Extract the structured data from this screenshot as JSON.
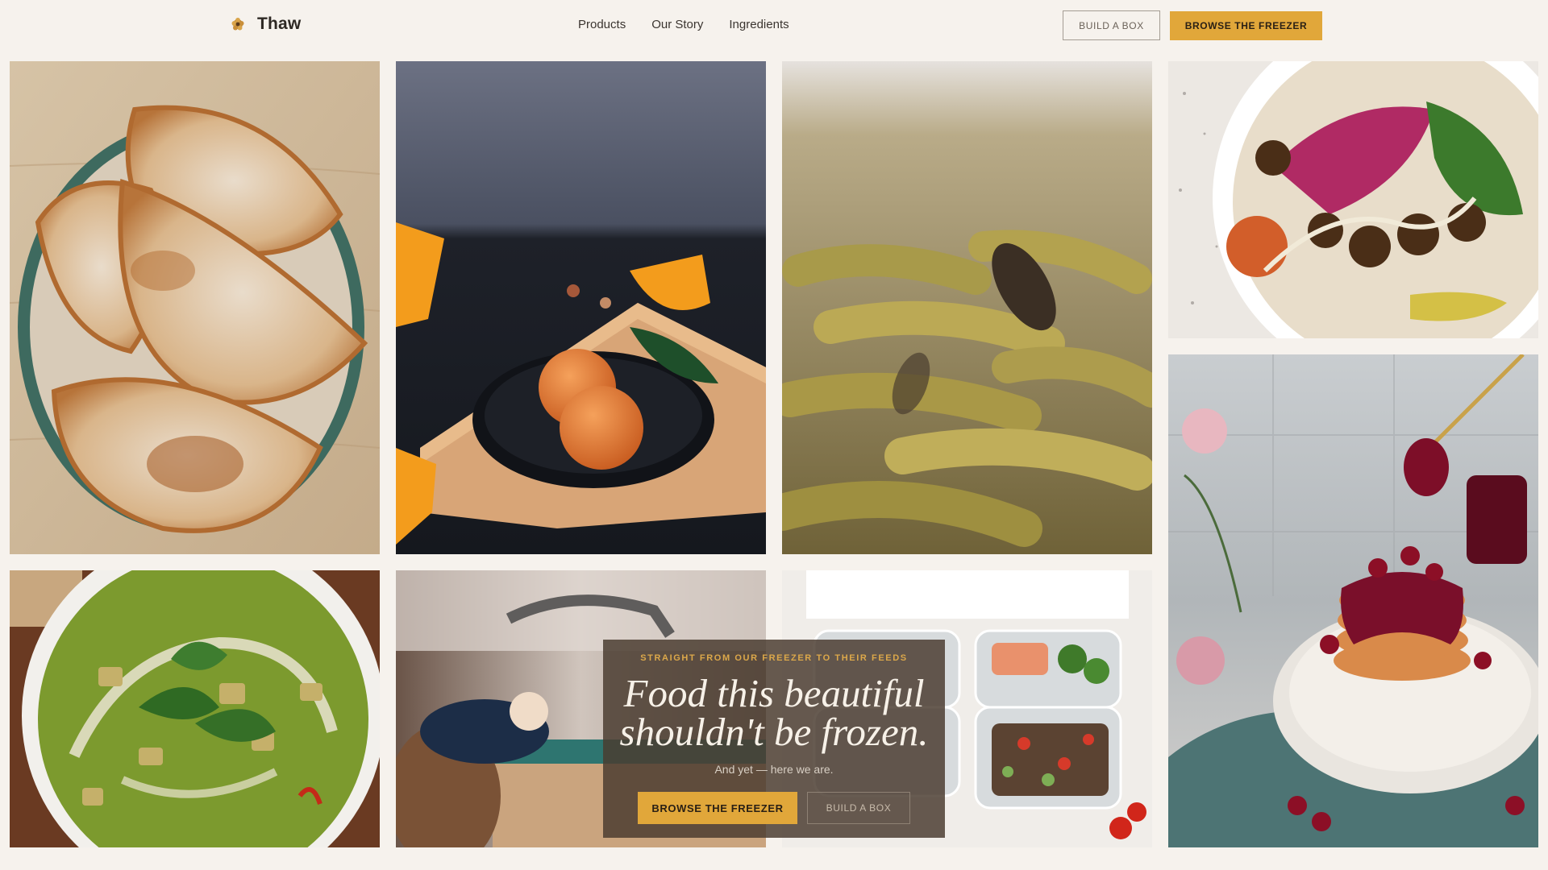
{
  "brand": {
    "name": "Thaw",
    "logo_icon": "flower-icon",
    "accent": "#e1a73a"
  },
  "nav": [
    {
      "label": "Products"
    },
    {
      "label": "Our Story"
    },
    {
      "label": "Ingredients"
    }
  ],
  "header_actions": {
    "build_label": "BUILD A BOX",
    "browse_label": "BROWSE THE FREEZER"
  },
  "hero": {
    "eyebrow": "STRAIGHT FROM OUR FREEZER TO THEIR FEEDS",
    "title_line1": "Food this beautiful",
    "title_line2": "shouldn't be frozen.",
    "subtitle": "And yet — here we are.",
    "browse_label": "BROWSE THE FREEZER",
    "build_label": "BUILD A BOX"
  }
}
